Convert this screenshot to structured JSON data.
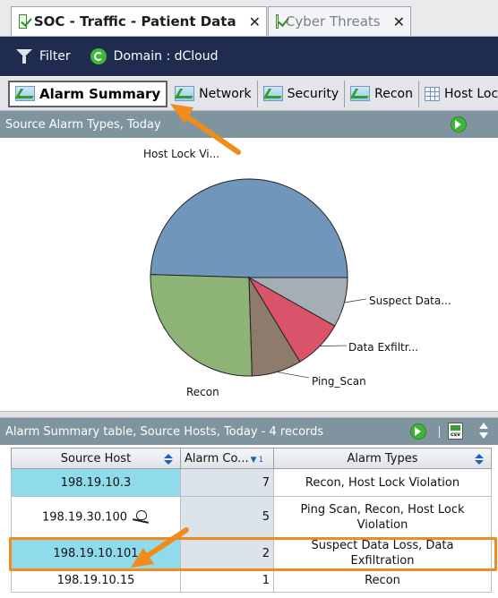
{
  "doc_tabs": [
    {
      "label": "SOC - Traffic - Patient Data",
      "close": "✕",
      "icon": "checkbox-icon"
    },
    {
      "label": "Cyber Threats",
      "close": "✕",
      "icon": "checkbox-icon"
    }
  ],
  "toolbar": {
    "filter_label": "Filter",
    "domain_label": "Domain : dCloud"
  },
  "sub_tabs": [
    {
      "label": "Alarm Summary",
      "icon": "chart-icon"
    },
    {
      "label": "Network",
      "icon": "chart-icon"
    },
    {
      "label": "Security",
      "icon": "chart-icon"
    },
    {
      "label": "Recon",
      "icon": "chart-icon"
    },
    {
      "label": "Host Lock",
      "icon": "grid-icon"
    }
  ],
  "chart_panel": {
    "title": "Source Alarm Types, Today"
  },
  "chart_data": {
    "type": "pie",
    "title": "",
    "series": [
      {
        "label": "Host Lock Vi...",
        "value": 2,
        "color": "#7097bb"
      },
      {
        "label": "Recon",
        "value": 1.05,
        "color": "#8db377"
      },
      {
        "label": "Ping_Scan",
        "value": 0.33,
        "color": "#8f7b6c"
      },
      {
        "label": "Data Exfiltr...",
        "value": 0.33,
        "color": "#d9546a"
      },
      {
        "label": "Suspect Data...",
        "value": 0.33,
        "color": "#a5adb5"
      }
    ]
  },
  "table_panel": {
    "title": "Alarm Summary table, Source Hosts, Today - 4 records",
    "csv_label": "csv"
  },
  "table": {
    "columns": [
      "Source Host",
      "Alarm Co...",
      "Alarm Types"
    ],
    "sort_indicator": "1",
    "rows": [
      {
        "host": "198.19.10.3",
        "count": "7",
        "types": "Recon, Host Lock Violation"
      },
      {
        "host": "198.19.30.100",
        "count": "5",
        "types": "Ping Scan, Recon, Host Lock Violation",
        "icon": "skull-icon"
      },
      {
        "host": "198.19.10.101",
        "count": "2",
        "types": "Suspect Data Loss, Data Exfiltration"
      },
      {
        "host": "198.19.10.15",
        "count": "1",
        "types": "Recon"
      }
    ]
  },
  "colors": {
    "toolbar_bg": "#1f2c4f",
    "panel_header_bg": "#7f949f",
    "host_cell_bg": "#8fdbeb",
    "highlight": "#f08b1e"
  }
}
